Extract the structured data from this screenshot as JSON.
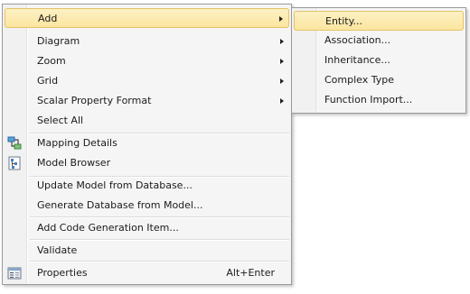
{
  "menu": {
    "items": [
      {
        "label": "Add",
        "submenu": true
      },
      {
        "label": "Diagram",
        "submenu": true
      },
      {
        "label": "Zoom",
        "submenu": true
      },
      {
        "label": "Grid",
        "submenu": true
      },
      {
        "label": "Scalar Property Format",
        "submenu": true
      },
      {
        "label": "Select All"
      },
      {
        "label": "Mapping Details",
        "icon": "mapping-details-icon"
      },
      {
        "label": "Model Browser",
        "icon": "model-browser-icon"
      },
      {
        "label": "Update Model from Database..."
      },
      {
        "label": "Generate Database from Model..."
      },
      {
        "label": "Add Code Generation Item..."
      },
      {
        "label": "Validate"
      },
      {
        "label": "Properties",
        "icon": "properties-icon",
        "shortcut": "Alt+Enter"
      }
    ]
  },
  "submenu": {
    "items": [
      {
        "label": "Entity..."
      },
      {
        "label": "Association..."
      },
      {
        "label": "Inheritance..."
      },
      {
        "label": "Complex Type"
      },
      {
        "label": "Function Import..."
      }
    ]
  },
  "colors": {
    "highlight_fill": "#fbe59f",
    "highlight_border": "#e5c365",
    "menu_background": "#f5f5f5",
    "menu_border": "#9a9a9a"
  }
}
